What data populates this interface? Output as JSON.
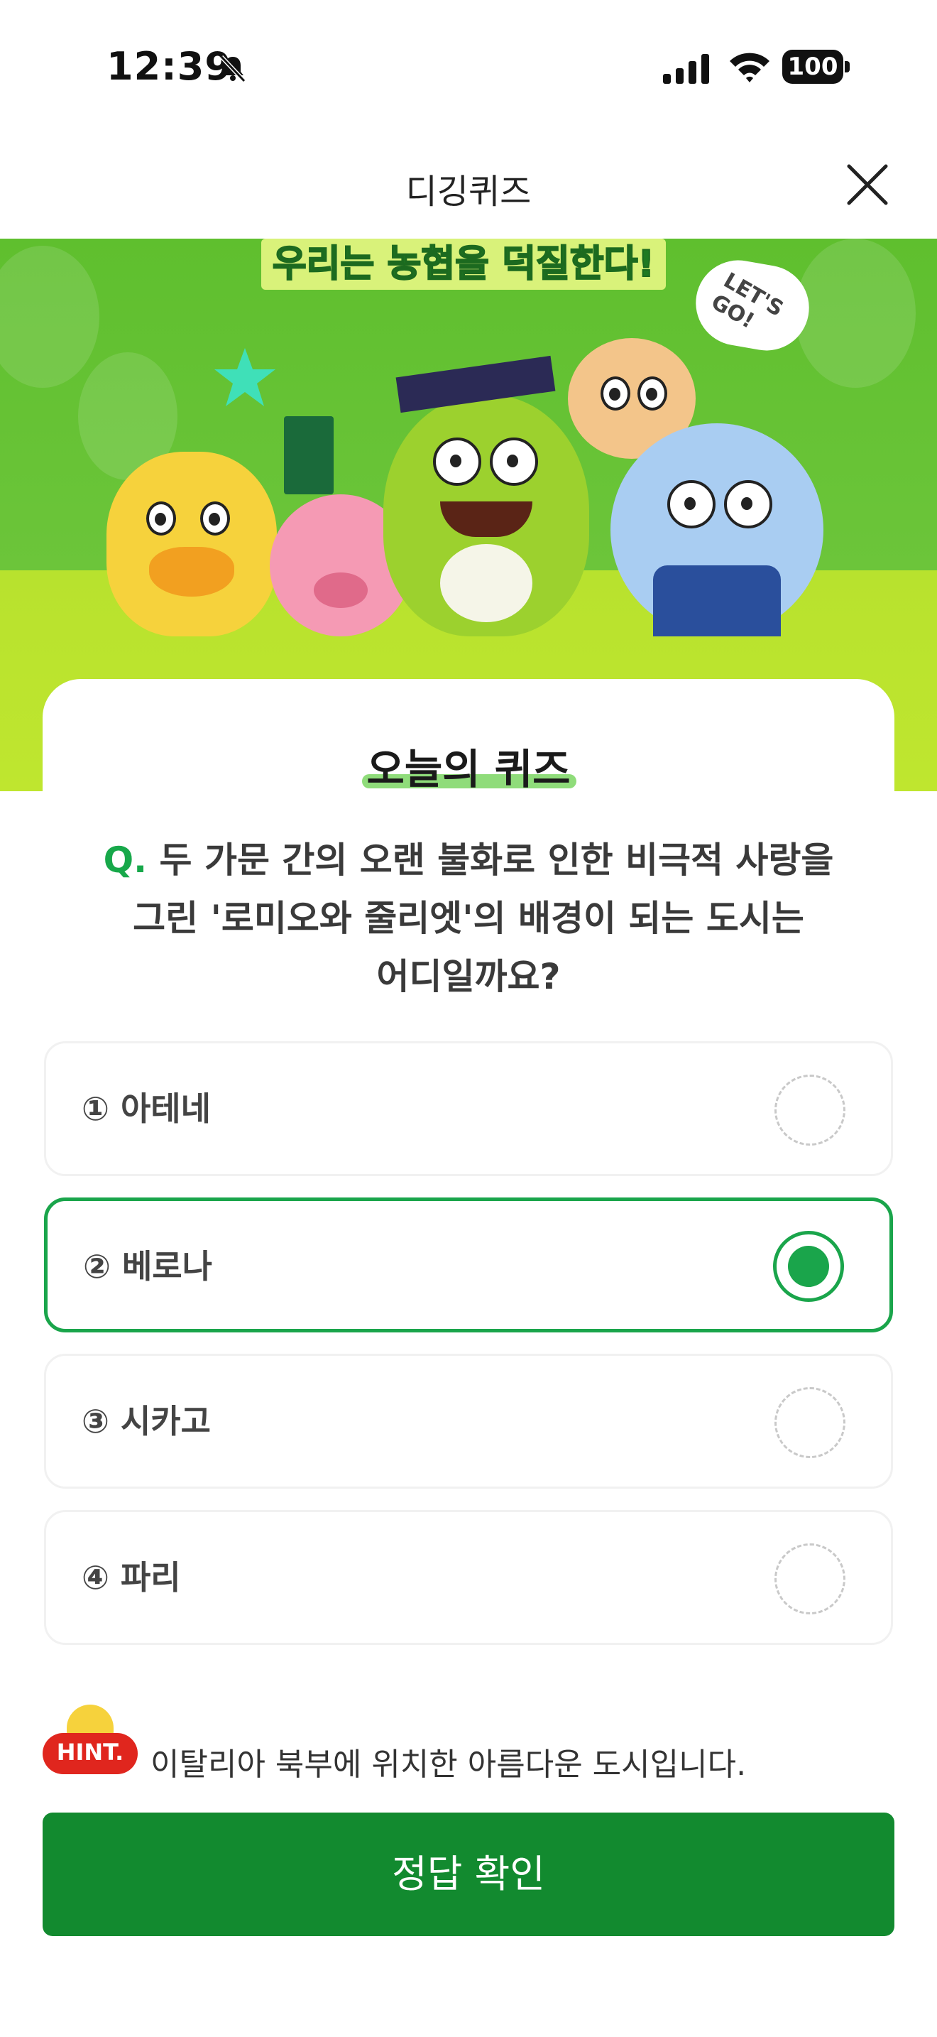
{
  "status_bar": {
    "time": "12:39",
    "battery": "100"
  },
  "nav": {
    "title": "디깅퀴즈"
  },
  "banner": {
    "headline": "우리는 농협을 덕질한다!",
    "bubble": "LET'S GO!"
  },
  "quiz": {
    "heading": "오늘의 퀴즈",
    "question_prefix": "Q.",
    "question_line1": "두 가문 간의 오랜 불화로 인한 비극적 사랑을",
    "question_line2": "그린 '로미오와 줄리엣'의 배경이 되는 도시는",
    "question_line3": "어디일까요?",
    "options": [
      {
        "label": "① 아테네",
        "selected": false
      },
      {
        "label": "② 베로나",
        "selected": true
      },
      {
        "label": "③ 시카고",
        "selected": false
      },
      {
        "label": "④ 파리",
        "selected": false
      }
    ]
  },
  "hint": {
    "badge": "HINT.",
    "text": "이탈리아 북부에 위치한 아름다운 도시입니다."
  },
  "confirm_button": {
    "label": "정답 확인"
  },
  "colors": {
    "accent": "#1aa54b",
    "button": "#128a2f",
    "banner_green": "#6cc53a",
    "hint_red": "#e0261e"
  }
}
